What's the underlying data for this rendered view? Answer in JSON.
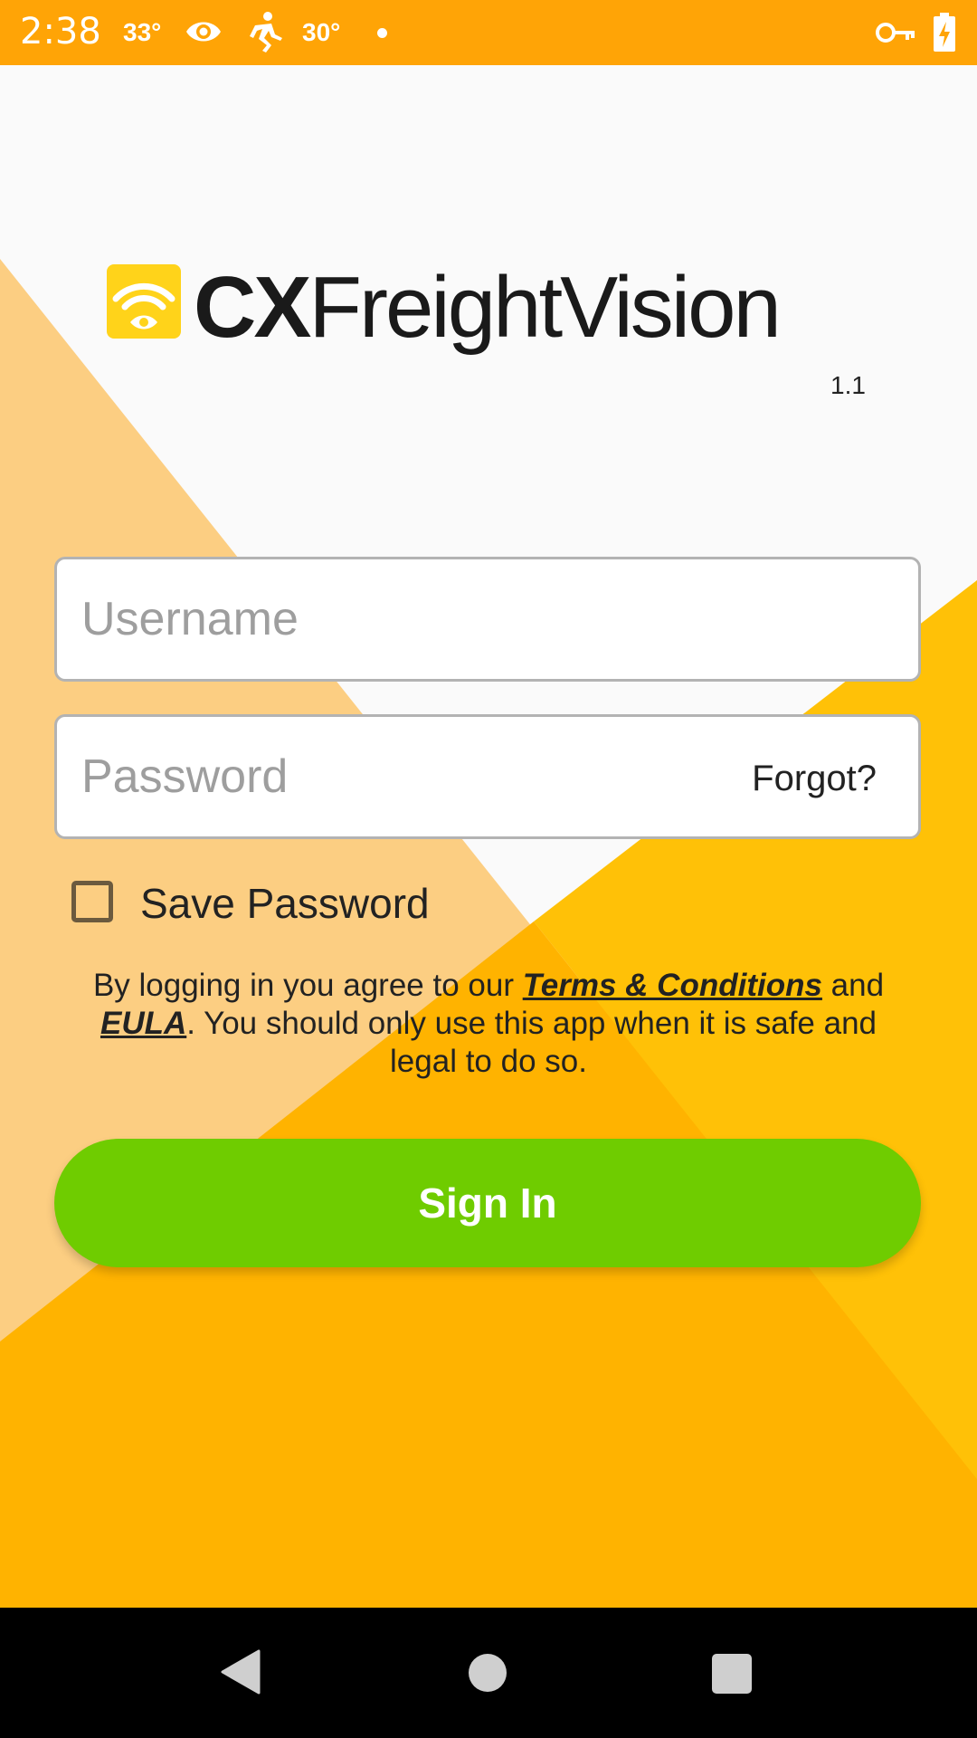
{
  "status_bar": {
    "time": "2:38",
    "temp1": "33°",
    "temp2": "30°",
    "icons": [
      "eye-icon",
      "runner-icon",
      "dot-icon",
      "key-icon",
      "battery-charging-icon"
    ]
  },
  "app": {
    "logo_part1": "CX",
    "logo_part2": "FreightVision",
    "version": "1.1"
  },
  "form": {
    "username_placeholder": "Username",
    "password_placeholder": "Password",
    "forgot_label": "Forgot?",
    "save_password_label": "Save Password",
    "save_password_checked": false
  },
  "terms": {
    "prefix": "By logging in you agree to our ",
    "terms_link": "Terms & Conditions",
    "middle": " and ",
    "eula_link": "EULA",
    "suffix": ". You should only use this app when it is safe and legal to do so."
  },
  "signin_label": "Sign In",
  "colors": {
    "status_bar": "#FFA406",
    "accent_orange": "#FFB300",
    "light_orange": "#FCCE82",
    "sign_in_green": "#6FCC00"
  }
}
